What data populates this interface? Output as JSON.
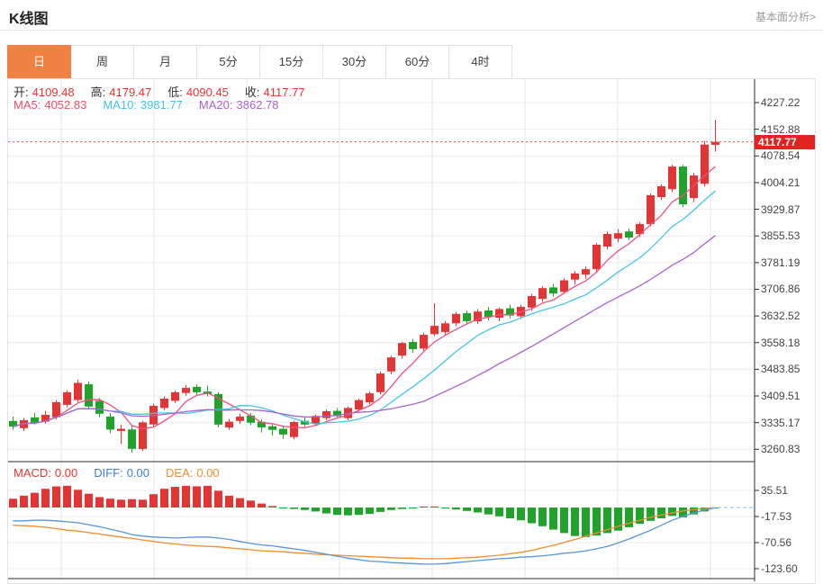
{
  "header": {
    "title": "K线图",
    "link": "基本面分析>"
  },
  "tabs": [
    {
      "label": "日",
      "active": true
    },
    {
      "label": "周",
      "active": false
    },
    {
      "label": "月",
      "active": false
    },
    {
      "label": "5分",
      "active": false
    },
    {
      "label": "15分",
      "active": false
    },
    {
      "label": "30分",
      "active": false
    },
    {
      "label": "60分",
      "active": false
    },
    {
      "label": "4时",
      "active": false
    }
  ],
  "legend_ohlc": [
    {
      "label": "开:",
      "value": "4109.48"
    },
    {
      "label": "高:",
      "value": "4179.47"
    },
    {
      "label": "低:",
      "value": "4090.45"
    },
    {
      "label": "收:",
      "value": "4117.77"
    }
  ],
  "legend_ma": [
    {
      "label": "MA5:",
      "value": "4052.83",
      "color": "#ee4f6e"
    },
    {
      "label": "MA10:",
      "value": "3981.77",
      "color": "#45c5e5"
    },
    {
      "label": "MA20:",
      "value": "3862.78",
      "color": "#a963c9"
    }
  ],
  "legend_macd": [
    {
      "label": "MACD:",
      "value": "0.00",
      "color": "#e83333"
    },
    {
      "label": "DIFF:",
      "value": "0.00",
      "color": "#3c7fd0"
    },
    {
      "label": "DEA:",
      "value": "0.00",
      "color": "#ef8d31"
    }
  ],
  "colors": {
    "up": "#e23535",
    "down": "#1fa32b",
    "ma5": "#ee517c",
    "ma10": "#45c5e5",
    "ma20": "#a963c9",
    "diff": "#5596d8",
    "dea": "#ef8d31",
    "grid": "#ececec",
    "vgrid": "#e6e6e6",
    "axis": "#2b2b2b",
    "dotted_price_line": "#e84040",
    "dashed_zero_line": "#a8d4f0",
    "value_red": "#e83333",
    "label_dark": "#333333",
    "badge_bg": "#e32222",
    "tab_active": "#ef8243"
  },
  "chart_data": {
    "type": "candlestick+macd",
    "title": "K线图 日线",
    "last_price_label": "4117.77",
    "price_axis_labels": [
      "4227.22",
      "4152.88",
      "4078.54",
      "4004.21",
      "3929.87",
      "3855.53",
      "3781.19",
      "3706.86",
      "3632.52",
      "3558.18",
      "3483.85",
      "3409.51",
      "3335.17",
      "3260.83"
    ],
    "price_axis_top_value": 4227.22,
    "price_axis_step": 74.335,
    "macd_axis_labels": [
      "35.51",
      "-17.53",
      "-70.56",
      "-123.60"
    ],
    "macd_axis_top_value": 35.51,
    "macd_axis_step": 53.04,
    "candles_ohlc": [
      [
        3340,
        3352,
        3316,
        3324
      ],
      [
        3320,
        3348,
        3312,
        3342
      ],
      [
        3350,
        3362,
        3330,
        3335
      ],
      [
        3338,
        3368,
        3332,
        3357
      ],
      [
        3350,
        3398,
        3344,
        3392
      ],
      [
        3385,
        3426,
        3378,
        3420
      ],
      [
        3398,
        3455,
        3392,
        3446
      ],
      [
        3442,
        3450,
        3372,
        3380
      ],
      [
        3396,
        3404,
        3350,
        3360
      ],
      [
        3352,
        3362,
        3306,
        3316
      ],
      [
        3312,
        3330,
        3276,
        3318
      ],
      [
        3316,
        3326,
        3252,
        3262
      ],
      [
        3262,
        3340,
        3256,
        3336
      ],
      [
        3330,
        3388,
        3324,
        3382
      ],
      [
        3376,
        3408,
        3370,
        3402
      ],
      [
        3396,
        3425,
        3390,
        3420
      ],
      [
        3418,
        3440,
        3410,
        3432
      ],
      [
        3435,
        3442,
        3412,
        3420
      ],
      [
        3422,
        3438,
        3408,
        3415
      ],
      [
        3415,
        3420,
        3322,
        3330
      ],
      [
        3322,
        3345,
        3315,
        3338
      ],
      [
        3340,
        3360,
        3332,
        3352
      ],
      [
        3355,
        3362,
        3328,
        3335
      ],
      [
        3338,
        3344,
        3308,
        3322
      ],
      [
        3325,
        3332,
        3300,
        3315
      ],
      [
        3318,
        3325,
        3290,
        3302
      ],
      [
        3295,
        3340,
        3288,
        3337
      ],
      [
        3340,
        3350,
        3324,
        3330
      ],
      [
        3332,
        3358,
        3326,
        3354
      ],
      [
        3348,
        3372,
        3342,
        3367
      ],
      [
        3368,
        3376,
        3348,
        3353
      ],
      [
        3348,
        3380,
        3342,
        3376
      ],
      [
        3372,
        3402,
        3366,
        3398
      ],
      [
        3392,
        3422,
        3386,
        3417
      ],
      [
        3420,
        3478,
        3414,
        3472
      ],
      [
        3478,
        3522,
        3470,
        3517
      ],
      [
        3522,
        3560,
        3514,
        3557
      ],
      [
        3560,
        3568,
        3530,
        3540
      ],
      [
        3542,
        3586,
        3536,
        3580
      ],
      [
        3582,
        3668,
        3576,
        3605
      ],
      [
        3588,
        3618,
        3580,
        3612
      ],
      [
        3612,
        3644,
        3604,
        3638
      ],
      [
        3640,
        3648,
        3608,
        3618
      ],
      [
        3618,
        3652,
        3610,
        3645
      ],
      [
        3648,
        3658,
        3620,
        3630
      ],
      [
        3628,
        3656,
        3618,
        3652
      ],
      [
        3654,
        3664,
        3626,
        3634
      ],
      [
        3632,
        3664,
        3624,
        3658
      ],
      [
        3656,
        3694,
        3648,
        3688
      ],
      [
        3680,
        3716,
        3672,
        3710
      ],
      [
        3712,
        3722,
        3686,
        3695
      ],
      [
        3700,
        3738,
        3694,
        3732
      ],
      [
        3734,
        3758,
        3720,
        3751
      ],
      [
        3748,
        3770,
        3736,
        3763
      ],
      [
        3763,
        3836,
        3756,
        3831
      ],
      [
        3826,
        3868,
        3818,
        3861
      ],
      [
        3848,
        3874,
        3838,
        3863
      ],
      [
        3868,
        3876,
        3844,
        3851
      ],
      [
        3861,
        3894,
        3853,
        3889
      ],
      [
        3889,
        3974,
        3882,
        3969
      ],
      [
        3964,
        4000,
        3956,
        3994
      ],
      [
        3986,
        4054,
        3978,
        4049
      ],
      [
        4049,
        4054,
        3936,
        3944
      ],
      [
        3961,
        4032,
        3950,
        4024
      ],
      [
        4001,
        4120,
        3993,
        4110
      ],
      [
        4109.48,
        4179.47,
        4090.45,
        4117.77
      ]
    ],
    "ma_periods": [
      5,
      10,
      20
    ],
    "macd": {
      "hist": [
        18,
        24,
        30,
        38,
        43,
        44,
        36,
        28,
        21,
        18,
        16,
        17,
        16,
        27,
        38,
        42,
        44,
        43,
        44,
        34,
        24,
        19,
        14,
        8,
        3,
        -2,
        -3,
        -5,
        -8,
        -12,
        -15,
        -16,
        -15,
        -13,
        -9,
        -5,
        -3,
        -2,
        2,
        2,
        -2,
        -4,
        -7,
        -10,
        -14,
        -18,
        -22,
        -26,
        -32,
        -38,
        -45,
        -52,
        -58,
        -60,
        -57,
        -52,
        -47,
        -40,
        -33,
        -27,
        -22,
        -17,
        -20,
        -14,
        -8,
        -2
      ],
      "diff": [
        -27,
        -27,
        -26,
        -26,
        -27,
        -29,
        -31,
        -35,
        -39,
        -44,
        -49,
        -55,
        -58,
        -60,
        -61,
        -62,
        -61,
        -60,
        -60,
        -62,
        -65,
        -69,
        -73,
        -76,
        -78,
        -81,
        -84,
        -87,
        -91,
        -95,
        -99,
        -103,
        -106,
        -109,
        -110,
        -112,
        -113,
        -114,
        -115,
        -115,
        -114,
        -112,
        -110,
        -108,
        -106,
        -104,
        -103,
        -101,
        -100,
        -98,
        -96,
        -93,
        -91,
        -88,
        -84,
        -79,
        -72,
        -64,
        -55,
        -46,
        -36,
        -26,
        -18,
        -11,
        -5,
        -1
      ],
      "dea": [
        -36,
        -37,
        -38,
        -40,
        -43,
        -46,
        -48,
        -51,
        -54,
        -57,
        -60,
        -63,
        -66,
        -69,
        -72,
        -74,
        -76,
        -78,
        -79,
        -80,
        -82,
        -84,
        -86,
        -88,
        -89,
        -90,
        -92,
        -93,
        -95,
        -96,
        -97,
        -98,
        -99,
        -100,
        -101,
        -102,
        -103,
        -103,
        -104,
        -104,
        -104,
        -103,
        -102,
        -101,
        -99,
        -97,
        -94,
        -91,
        -87,
        -82,
        -77,
        -71,
        -65,
        -58,
        -52,
        -45,
        -38,
        -32,
        -26,
        -20,
        -15,
        -11,
        -7,
        -4,
        -2,
        0
      ]
    }
  }
}
